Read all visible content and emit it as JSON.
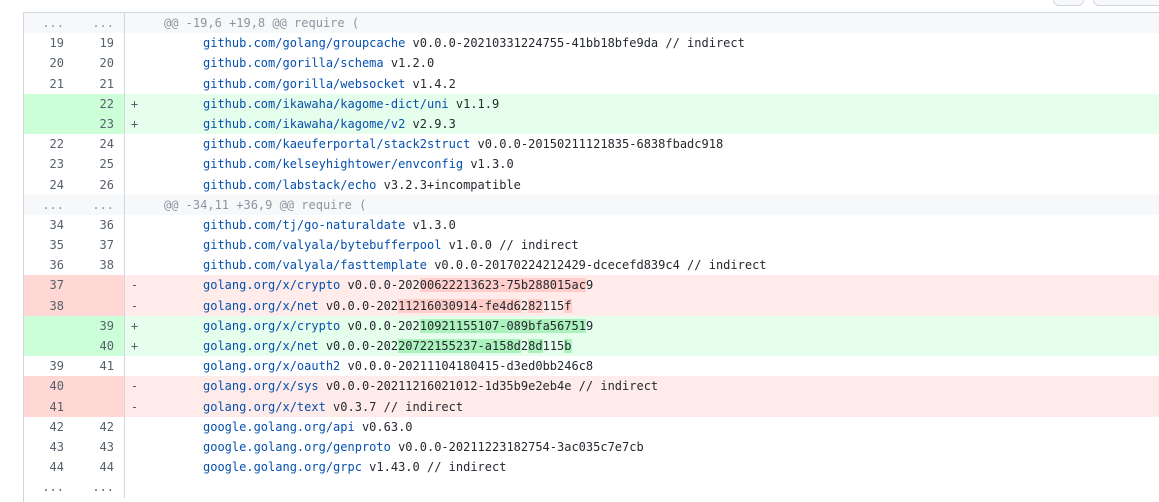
{
  "hunks": [
    {
      "header": "@@ -19,6 +19,8 @@ require (",
      "lines": [
        {
          "type": "context",
          "old": "19",
          "new": "19",
          "segments": [
            {
              "t": "github.com/golang/groupcache",
              "c": "pkg"
            },
            {
              "t": " v0.0.0-20210331224755-41bb18bfe9da // indirect"
            }
          ]
        },
        {
          "type": "context",
          "old": "20",
          "new": "20",
          "segments": [
            {
              "t": "github.com/gorilla/schema",
              "c": "pkg"
            },
            {
              "t": " v1.2.0"
            }
          ]
        },
        {
          "type": "context",
          "old": "21",
          "new": "21",
          "segments": [
            {
              "t": "github.com/gorilla/websocket",
              "c": "pkg"
            },
            {
              "t": " v1.4.2"
            }
          ]
        },
        {
          "type": "add",
          "old": "",
          "new": "22",
          "segments": [
            {
              "t": "github.com/ikawaha/kagome-dict/uni",
              "c": "pkg"
            },
            {
              "t": " v1.1.9"
            }
          ]
        },
        {
          "type": "add",
          "old": "",
          "new": "23",
          "segments": [
            {
              "t": "github.com/ikawaha/kagome/v2",
              "c": "pkg"
            },
            {
              "t": " v2.9.3"
            }
          ]
        },
        {
          "type": "context",
          "old": "22",
          "new": "24",
          "segments": [
            {
              "t": "github.com/kaeuferportal/stack2struct",
              "c": "pkg"
            },
            {
              "t": " v0.0.0-20150211121835-6838fbadc918"
            }
          ]
        },
        {
          "type": "context",
          "old": "23",
          "new": "25",
          "segments": [
            {
              "t": "github.com/kelseyhightower/envconfig",
              "c": "pkg"
            },
            {
              "t": " v1.3.0"
            }
          ]
        },
        {
          "type": "context",
          "old": "24",
          "new": "26",
          "segments": [
            {
              "t": "github.com/labstack/echo",
              "c": "pkg"
            },
            {
              "t": " v3.2.3+incompatible"
            }
          ]
        }
      ]
    },
    {
      "header": "@@ -34,11 +36,9 @@ require (",
      "lines": [
        {
          "type": "context",
          "old": "34",
          "new": "36",
          "segments": [
            {
              "t": "github.com/tj/go-naturaldate",
              "c": "pkg"
            },
            {
              "t": " v1.3.0"
            }
          ]
        },
        {
          "type": "context",
          "old": "35",
          "new": "37",
          "segments": [
            {
              "t": "github.com/valyala/bytebufferpool",
              "c": "pkg"
            },
            {
              "t": " v1.0.0 // indirect"
            }
          ]
        },
        {
          "type": "context",
          "old": "36",
          "new": "38",
          "segments": [
            {
              "t": "github.com/valyala/fasttemplate",
              "c": "pkg"
            },
            {
              "t": " v0.0.0-20170224212429-dcecefd839c4 // indirect"
            }
          ]
        },
        {
          "type": "del",
          "old": "37",
          "new": "",
          "segments": [
            {
              "t": "golang.org/x/crypto",
              "c": "pkg"
            },
            {
              "t": " v0.0.0-202"
            },
            {
              "t": "00622213623-75b288015ac",
              "c": "hl-del"
            },
            {
              "t": "9"
            }
          ]
        },
        {
          "type": "del",
          "old": "38",
          "new": "",
          "segments": [
            {
              "t": "golang.org/x/net",
              "c": "pkg"
            },
            {
              "t": " v0.0.0-202"
            },
            {
              "t": "11216030914-fe4d6",
              "c": "hl-del"
            },
            {
              "t": "2"
            },
            {
              "t": "82",
              "c": "hl-del"
            },
            {
              "t": "115"
            },
            {
              "t": "f",
              "c": "hl-del"
            }
          ]
        },
        {
          "type": "add",
          "old": "",
          "new": "39",
          "segments": [
            {
              "t": "golang.org/x/crypto",
              "c": "pkg"
            },
            {
              "t": " v0.0.0-202"
            },
            {
              "t": "10921155107-089bfa56751",
              "c": "hl-add"
            },
            {
              "t": "9"
            }
          ]
        },
        {
          "type": "add",
          "old": "",
          "new": "40",
          "segments": [
            {
              "t": "golang.org/x/net",
              "c": "pkg"
            },
            {
              "t": " v0.0.0-202"
            },
            {
              "t": "20722155237-a158d",
              "c": "hl-add"
            },
            {
              "t": "2"
            },
            {
              "t": "8d",
              "c": "hl-add"
            },
            {
              "t": "115"
            },
            {
              "t": "b",
              "c": "hl-add"
            }
          ]
        },
        {
          "type": "context",
          "old": "39",
          "new": "41",
          "segments": [
            {
              "t": "golang.org/x/oauth2",
              "c": "pkg"
            },
            {
              "t": " v0.0.0-20211104180415-d3ed0bb246c8"
            }
          ]
        },
        {
          "type": "del",
          "old": "40",
          "new": "",
          "segments": [
            {
              "t": "golang.org/x/sys",
              "c": "pkg"
            },
            {
              "t": " v0.0.0-20211216021012-1d35b9e2eb4e // indirect"
            }
          ]
        },
        {
          "type": "del",
          "old": "41",
          "new": "",
          "segments": [
            {
              "t": "golang.org/x/text",
              "c": "pkg"
            },
            {
              "t": " v0.3.7 // indirect"
            }
          ]
        },
        {
          "type": "context",
          "old": "42",
          "new": "42",
          "segments": [
            {
              "t": "google.golang.org/api",
              "c": "pkg"
            },
            {
              "t": " v0.63.0"
            }
          ]
        },
        {
          "type": "context",
          "old": "43",
          "new": "43",
          "segments": [
            {
              "t": "google.golang.org/genproto",
              "c": "pkg"
            },
            {
              "t": " v0.0.0-20211223182754-3ac035c7e7cb"
            }
          ]
        },
        {
          "type": "context",
          "old": "44",
          "new": "44",
          "segments": [
            {
              "t": "google.golang.org/grpc",
              "c": "pkg"
            },
            {
              "t": " v1.43.0 // indirect"
            }
          ]
        }
      ]
    }
  ],
  "expander": {
    "old": "...",
    "new": "..."
  },
  "markers": {
    "add": "+",
    "del": "-",
    "context": ""
  },
  "colors": {
    "add_bg": "#e6ffec",
    "del_bg": "#ffebe9",
    "add_num_bg": "#ccffd8",
    "del_num_bg": "#ffd7d5",
    "hunk_bg": "#f6f8fa",
    "pkg": "#0550ae"
  }
}
